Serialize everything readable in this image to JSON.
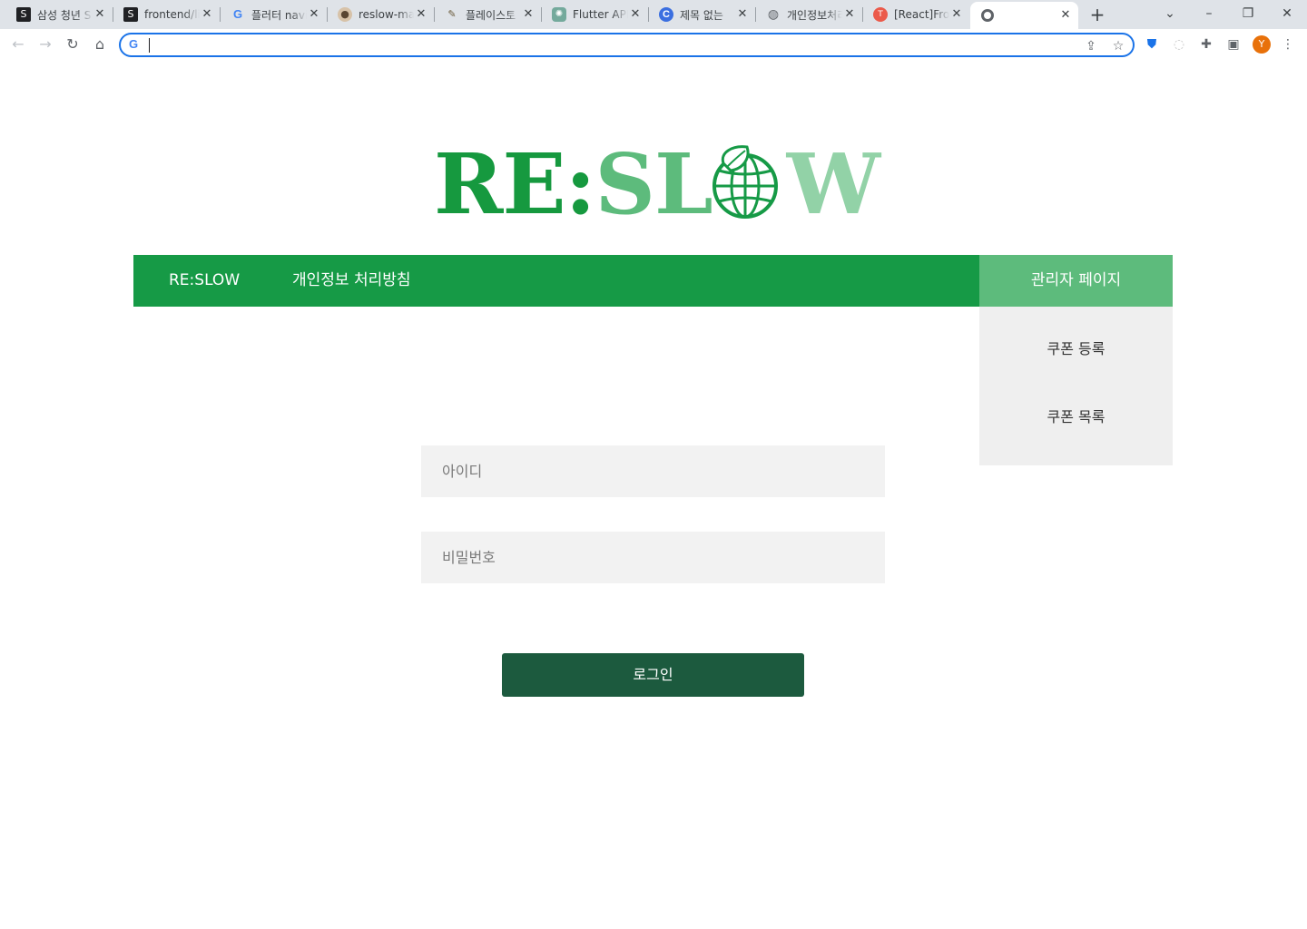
{
  "browser": {
    "tabs": [
      {
        "title": "삼성 청년 S",
        "icon": "black-s-icon",
        "active": false
      },
      {
        "title": "frontend/lib",
        "icon": "black-s-icon",
        "active": false
      },
      {
        "title": "플러터 navi",
        "icon": "google-icon",
        "active": false
      },
      {
        "title": "reslow-mai",
        "icon": "github-octocat-icon",
        "active": false
      },
      {
        "title": "플레이스토",
        "icon": "feather-icon",
        "active": false
      },
      {
        "title": "Flutter APK",
        "icon": "chatgpt-icon",
        "active": false
      },
      {
        "title": "제목 없는 ",
        "icon": "c-circle-icon",
        "active": false
      },
      {
        "title": "개인정보처리",
        "icon": "globe-icon",
        "active": false
      },
      {
        "title": "[React]Fron",
        "icon": "red-t-icon",
        "active": false
      },
      {
        "title": "",
        "icon": "chrome-icon",
        "active": true
      }
    ],
    "address_value": "",
    "profile_initial": "Y",
    "colors": {
      "tabstrip": "#dfe3e8",
      "omnibox_border": "#1a73e8",
      "avatar": "#e8710a"
    }
  },
  "page": {
    "logo": {
      "part_re": "RE:",
      "part_sl": "SL",
      "part_w": "W"
    },
    "nav": {
      "brand": "RE:SLOW",
      "privacy": "개인정보 처리방침",
      "admin": "관리자 페이지"
    },
    "admin_menu": [
      "쿠폰 등록",
      "쿠폰 목록"
    ],
    "login": {
      "id_placeholder": "아이디",
      "pw_placeholder": "비밀번호",
      "submit": "로그인"
    },
    "colors": {
      "nav_bg": "#169a46",
      "admin_bg": "#5dbb7c",
      "dropdown_bg": "#efefef",
      "input_bg": "#f2f2f2",
      "button_bg": "#1c5a3e"
    }
  }
}
